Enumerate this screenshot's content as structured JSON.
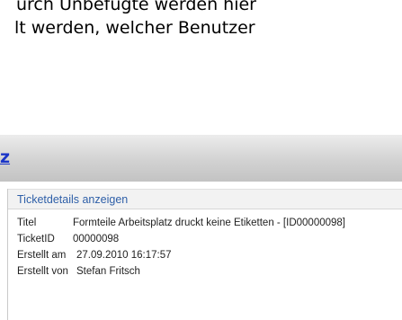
{
  "document": {
    "line_1": "urch Unbefugte werden hier",
    "line_2": "lt werden, welcher Benutzer"
  },
  "header": {
    "link_text": "z",
    "colors": {
      "link": "#1a35c8",
      "bar_top": "#ececec",
      "bar_bottom": "#c3c3c3"
    }
  },
  "ticket_details": {
    "section_title": "Ticketdetails anzeigen",
    "rows": [
      {
        "label": "Titel",
        "value": "Formteile Arbeitsplatz druckt keine Etiketten - [ID00000098]"
      },
      {
        "label": "TicketID",
        "value": "00000098"
      },
      {
        "label": "Erstellt am",
        "value": "27.09.2010 16:17:57"
      },
      {
        "label": "Erstellt von",
        "value": "Stefan Fritsch"
      }
    ]
  }
}
